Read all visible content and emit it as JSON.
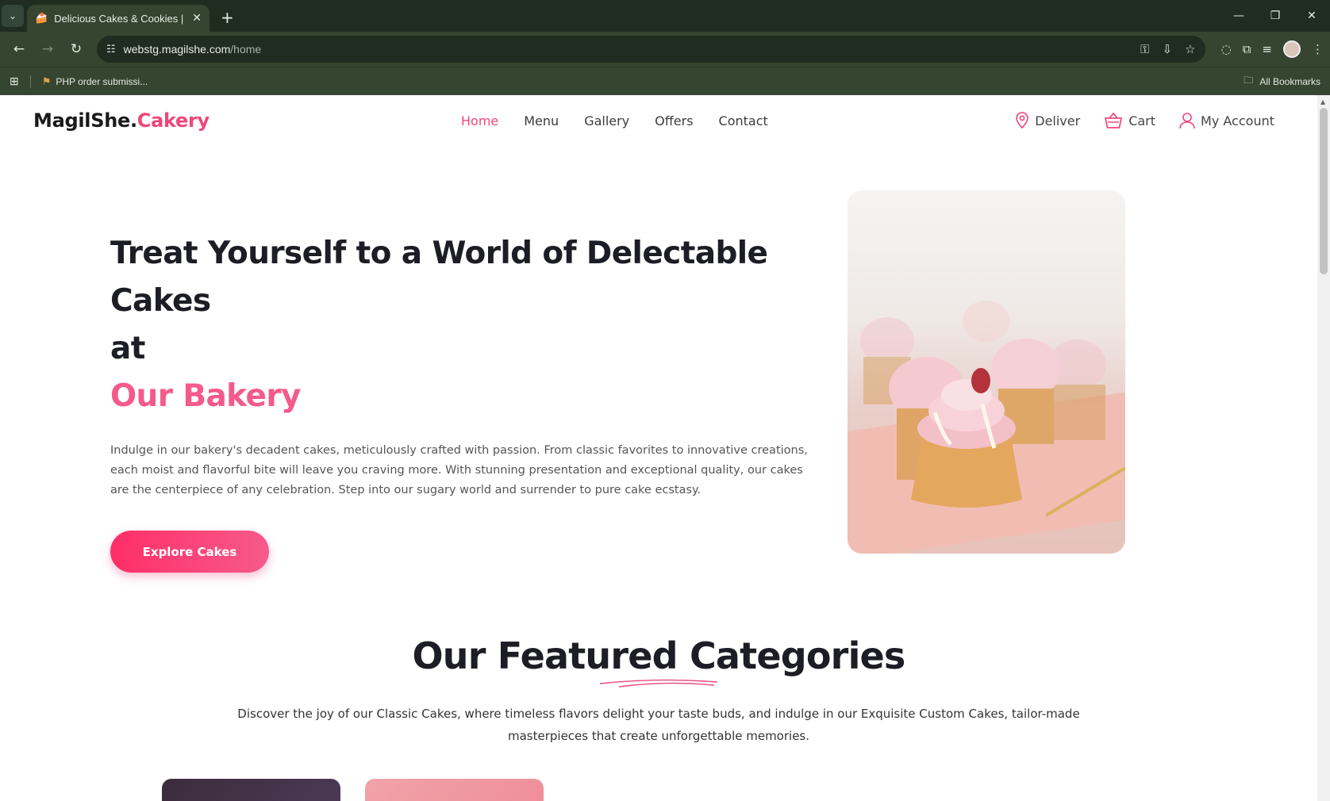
{
  "browser": {
    "tab_title": "Delicious Cakes & Cookies | Ma",
    "url_host": "webstg.magilshe.com",
    "url_path": "/home",
    "bookmark_item": "PHP order submissi...",
    "all_bookmarks": "All Bookmarks"
  },
  "site": {
    "logo_main": "MagilShe.",
    "logo_accent": "Cakery",
    "nav": [
      "Home",
      "Menu",
      "Gallery",
      "Offers",
      "Contact"
    ],
    "actions": {
      "deliver": "Deliver",
      "cart": "Cart",
      "account": "My Account"
    }
  },
  "hero": {
    "heading_line1": "Treat Yourself to a World of Delectable Cakes",
    "heading_line2": "at",
    "heading_accent": "Our Bakery",
    "description": "Indulge in our bakery's decadent cakes, meticulously crafted with passion. From classic favorites to innovative creations, each moist and flavorful bite will leave you craving more. With stunning presentation and exceptional quality, our cakes are the centerpiece of any celebration. Step into our sugary world and surrender to pure cake ecstasy.",
    "cta": "Explore Cakes"
  },
  "featured": {
    "title": "Our Featured Categories",
    "description": "Discover the joy of our Classic Cakes, where timeless flavors delight your taste buds, and indulge in our Exquisite Custom Cakes, tailor-made masterpieces that create unforgettable memories."
  },
  "colors": {
    "accent": "#f0467a",
    "hero_accent": "#f45a8a",
    "chrome": "#35452f"
  }
}
